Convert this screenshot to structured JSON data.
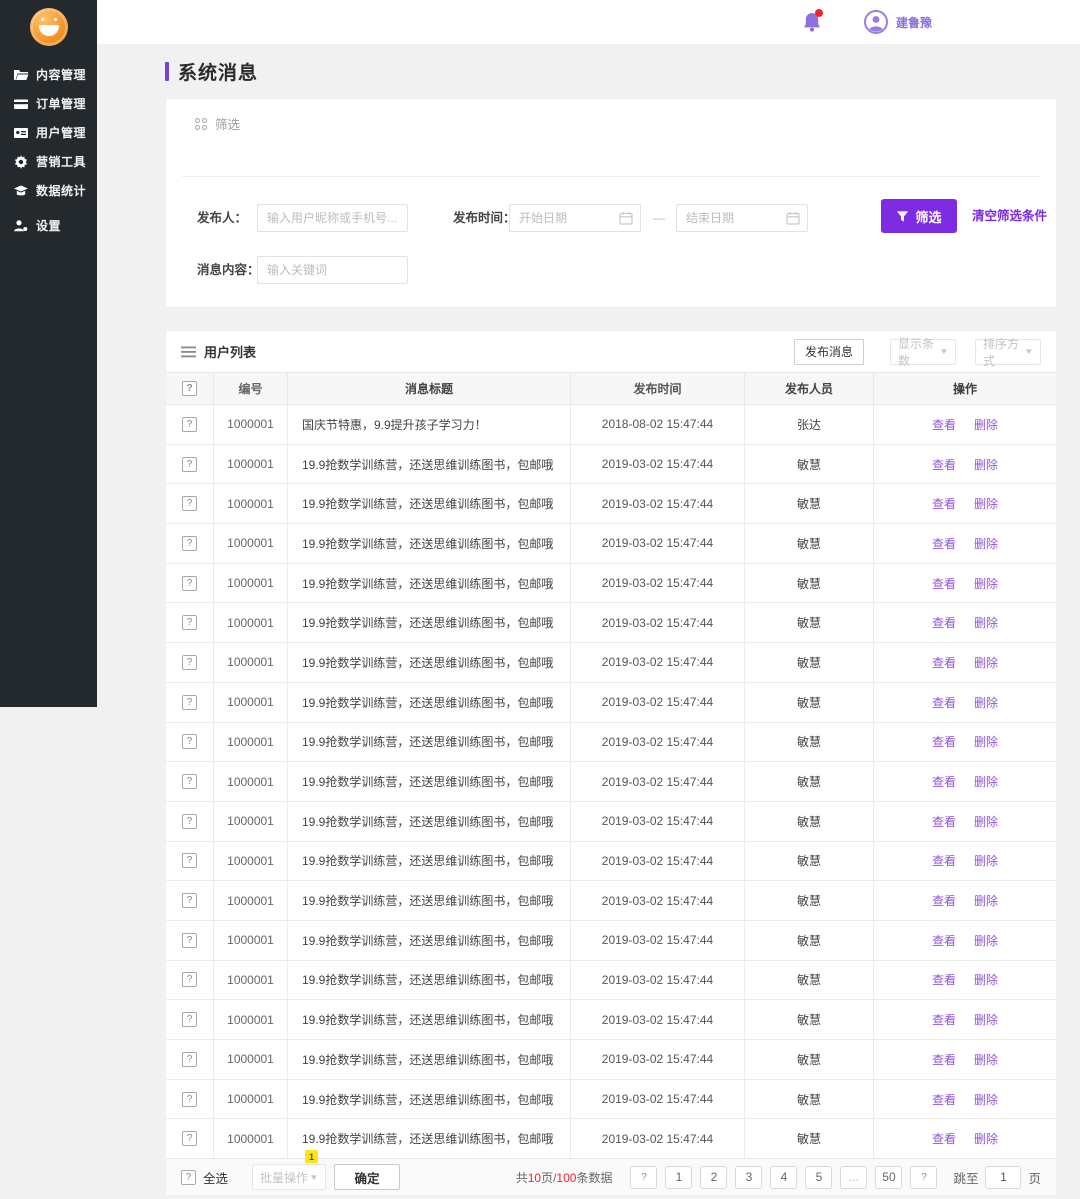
{
  "colors": {
    "primary": "#7d2ce4",
    "link": "#9254de",
    "danger": "#f5222d",
    "badge": "#ffe417",
    "sidebar": "#24292e"
  },
  "header": {
    "user_name": "建鲁豫"
  },
  "sidebar": {
    "items": [
      {
        "icon": "folder-icon",
        "label": "内容管理"
      },
      {
        "icon": "order-icon",
        "label": "订单管理"
      },
      {
        "icon": "idcard-icon",
        "label": "用户管理"
      },
      {
        "icon": "gear-icon",
        "label": "营销工具"
      },
      {
        "icon": "stats-icon",
        "label": "数据统计"
      },
      {
        "icon": "user-gear-icon",
        "label": "设置"
      }
    ]
  },
  "page": {
    "title": "系统消息"
  },
  "filter": {
    "section_label": "筛选",
    "publisher_label": "发布人：",
    "publisher_placeholder": "输入用户昵称或手机号...",
    "time_label": "发布时间：",
    "start_placeholder": "开始日期",
    "range_separator": "—",
    "end_placeholder": "结束日期",
    "content_label": "消息内容：",
    "content_placeholder": "输入关键词",
    "filter_button": "筛选",
    "clear_link": "清空筛选条件"
  },
  "table": {
    "list_title": "用户列表",
    "publish_button": "发布消息",
    "display_count_dropdown": "显示条数",
    "sort_dropdown": "排序方式",
    "columns": [
      "编号",
      "消息标题",
      "发布时间",
      "发布人员",
      "操作"
    ],
    "action_view": "查看",
    "action_delete": "删除",
    "rows": [
      {
        "id": "1000001",
        "title": "国庆节特惠，9.9提升孩子学习力！",
        "time": "2018-08-02 15:47:44",
        "publisher": "张达"
      },
      {
        "id": "1000001",
        "title": "19.9抢数学训练营，还送思维训练图书，包邮哦",
        "time": "2019-03-02 15:47:44",
        "publisher": "敏慧"
      },
      {
        "id": "1000001",
        "title": "19.9抢数学训练营，还送思维训练图书，包邮哦",
        "time": "2019-03-02 15:47:44",
        "publisher": "敏慧"
      },
      {
        "id": "1000001",
        "title": "19.9抢数学训练营，还送思维训练图书，包邮哦",
        "time": "2019-03-02 15:47:44",
        "publisher": "敏慧"
      },
      {
        "id": "1000001",
        "title": "19.9抢数学训练营，还送思维训练图书，包邮哦",
        "time": "2019-03-02 15:47:44",
        "publisher": "敏慧"
      },
      {
        "id": "1000001",
        "title": "19.9抢数学训练营，还送思维训练图书，包邮哦",
        "time": "2019-03-02 15:47:44",
        "publisher": "敏慧"
      },
      {
        "id": "1000001",
        "title": "19.9抢数学训练营，还送思维训练图书，包邮哦",
        "time": "2019-03-02 15:47:44",
        "publisher": "敏慧"
      },
      {
        "id": "1000001",
        "title": "19.9抢数学训练营，还送思维训练图书，包邮哦",
        "time": "2019-03-02 15:47:44",
        "publisher": "敏慧"
      },
      {
        "id": "1000001",
        "title": "19.9抢数学训练营，还送思维训练图书，包邮哦",
        "time": "2019-03-02 15:47:44",
        "publisher": "敏慧"
      },
      {
        "id": "1000001",
        "title": "19.9抢数学训练营，还送思维训练图书，包邮哦",
        "time": "2019-03-02 15:47:44",
        "publisher": "敏慧"
      },
      {
        "id": "1000001",
        "title": "19.9抢数学训练营，还送思维训练图书，包邮哦",
        "time": "2019-03-02 15:47:44",
        "publisher": "敏慧"
      },
      {
        "id": "1000001",
        "title": "19.9抢数学训练营，还送思维训练图书，包邮哦",
        "time": "2019-03-02 15:47:44",
        "publisher": "敏慧"
      },
      {
        "id": "1000001",
        "title": "19.9抢数学训练营，还送思维训练图书，包邮哦",
        "time": "2019-03-02 15:47:44",
        "publisher": "敏慧"
      },
      {
        "id": "1000001",
        "title": "19.9抢数学训练营，还送思维训练图书，包邮哦",
        "time": "2019-03-02 15:47:44",
        "publisher": "敏慧"
      },
      {
        "id": "1000001",
        "title": "19.9抢数学训练营，还送思维训练图书，包邮哦",
        "time": "2019-03-02 15:47:44",
        "publisher": "敏慧"
      },
      {
        "id": "1000001",
        "title": "19.9抢数学训练营，还送思维训练图书，包邮哦",
        "time": "2019-03-02 15:47:44",
        "publisher": "敏慧"
      },
      {
        "id": "1000001",
        "title": "19.9抢数学训练营，还送思维训练图书，包邮哦",
        "time": "2019-03-02 15:47:44",
        "publisher": "敏慧"
      },
      {
        "id": "1000001",
        "title": "19.9抢数学训练营，还送思维训练图书，包邮哦",
        "time": "2019-03-02 15:47:44",
        "publisher": "敏慧"
      },
      {
        "id": "1000001",
        "title": "19.9抢数学训练营，还送思维训练图书，包邮哦",
        "time": "2019-03-02 15:47:44",
        "publisher": "敏慧"
      }
    ]
  },
  "footer": {
    "select_all": "全选",
    "batch_action": "批量操作",
    "batch_badge": "1",
    "confirm_button": "确定",
    "summary": {
      "p1": "共",
      "pages": "10",
      "p2": "页/",
      "count": "100",
      "p3": "条数据"
    },
    "pages": [
      "1",
      "2",
      "3",
      "4",
      "5",
      "...",
      "50"
    ],
    "jump_label": "跳至",
    "jump_value": "1",
    "jump_suffix": "页"
  },
  "icons": {
    "placeholder": "?"
  }
}
